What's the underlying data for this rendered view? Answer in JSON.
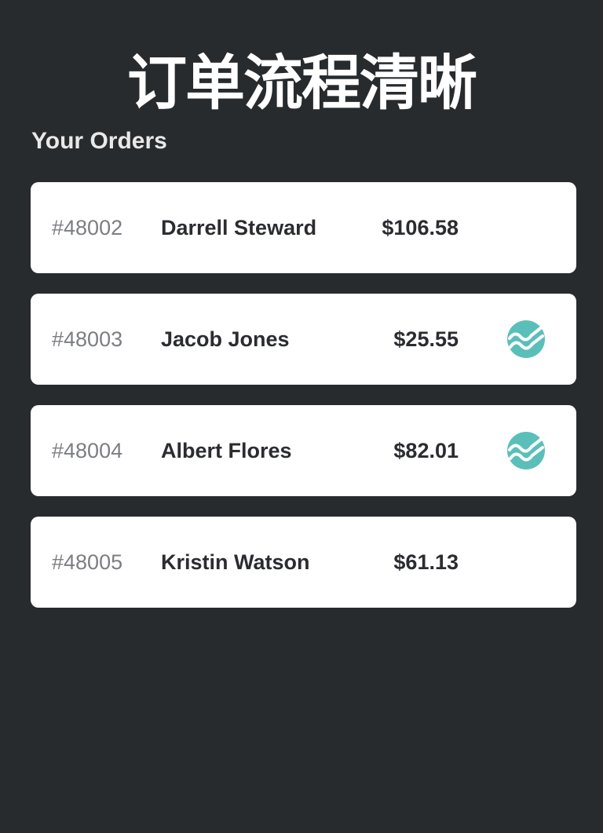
{
  "banner": {
    "text": "订单流程清晰"
  },
  "page": {
    "title": "Your Orders"
  },
  "colors": {
    "background": "#282b2e",
    "card": "#ffffff",
    "accent": "#5bbfb9"
  },
  "orders": [
    {
      "id": "#48002",
      "name": "Darrell Steward",
      "amount": "$106.58",
      "icon": null
    },
    {
      "id": "#48003",
      "name": "Jacob Jones",
      "amount": "$25.55",
      "icon": "trend-wave-icon"
    },
    {
      "id": "#48004",
      "name": "Albert Flores",
      "amount": "$82.01",
      "icon": "trend-wave-icon"
    },
    {
      "id": "#48005",
      "name": "Kristin Watson",
      "amount": "$61.13",
      "icon": null
    }
  ]
}
